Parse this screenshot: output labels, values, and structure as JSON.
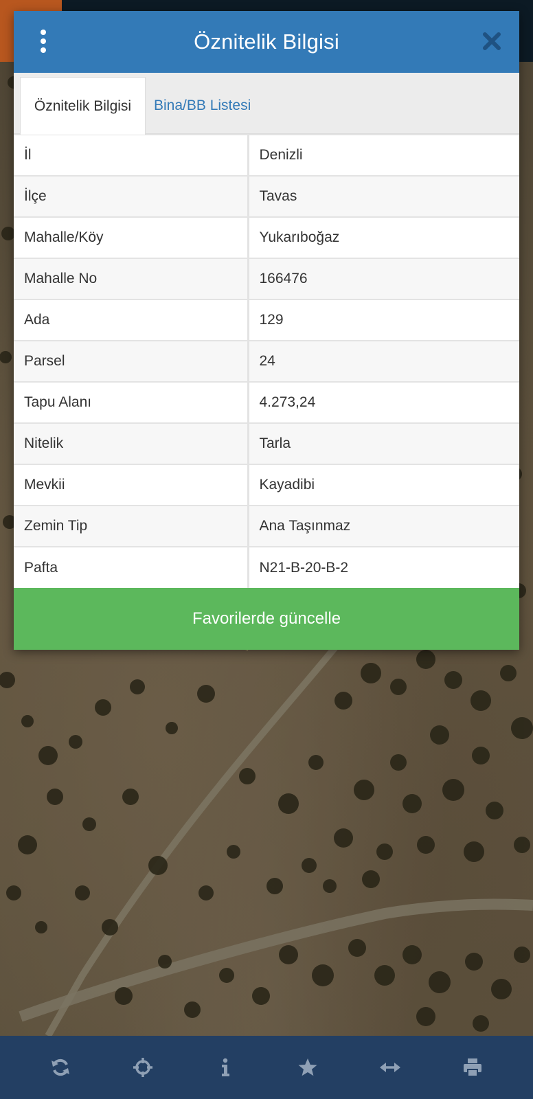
{
  "modal": {
    "title": "Öznitelik Bilgisi",
    "tabs": [
      {
        "label": "Öznitelik Bilgisi",
        "active": true
      },
      {
        "label": "Bina/BB Listesi",
        "active": false
      }
    ],
    "rows": [
      {
        "key": "İl",
        "value": "Denizli"
      },
      {
        "key": "İlçe",
        "value": "Tavas"
      },
      {
        "key": "Mahalle/Köy",
        "value": "Yukarıboğaz"
      },
      {
        "key": "Mahalle No",
        "value": "166476"
      },
      {
        "key": "Ada",
        "value": "129"
      },
      {
        "key": "Parsel",
        "value": "24"
      },
      {
        "key": "Tapu Alanı",
        "value": "4.273,24"
      },
      {
        "key": "Nitelik",
        "value": "Tarla"
      },
      {
        "key": "Mevkii",
        "value": "Kayadibi"
      },
      {
        "key": "Zemin Tip",
        "value": "Ana Taşınmaz"
      },
      {
        "key": "Pafta",
        "value": "N21-B-20-B-2"
      }
    ],
    "favorite_button": "Favorilerde güncelle"
  },
  "toolbar": {
    "icons": [
      "refresh-icon",
      "crosshair-icon",
      "info-icon",
      "star-icon",
      "measure-icon",
      "print-icon"
    ]
  },
  "colors": {
    "header": "#337ab7",
    "button_success": "#5cb85c",
    "toolbar": "#233f63",
    "toolbar_icon": "#8fa0b5"
  }
}
